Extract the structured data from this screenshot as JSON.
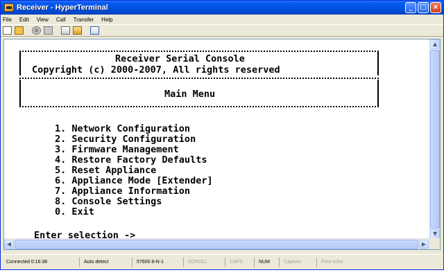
{
  "window": {
    "title": "Receiver - HyperTerminal",
    "controls": {
      "minimize": "_",
      "maximize": "□",
      "close": "×"
    }
  },
  "menubar": {
    "items": [
      "File",
      "Edit",
      "View",
      "Call",
      "Transfer",
      "Help"
    ]
  },
  "toolbar": {
    "icons": [
      "new-icon",
      "open-icon",
      "connect-icon",
      "disconnect-icon",
      "send-icon",
      "receive-icon",
      "properties-icon"
    ]
  },
  "terminal": {
    "header_title": "Receiver Serial Console",
    "header_copyright": "Copyright (c) 2000-2007, All rights reserved",
    "menu_title": "Main Menu",
    "options": [
      "1. Network Configuration",
      "2. Security Configuration",
      "3. Firmware Management",
      "4. Restore Factory Defaults",
      "5. Reset Appliance",
      "6. Appliance Mode [Extender]",
      "7. Appliance Information",
      "8. Console Settings",
      "0. Exit"
    ],
    "prompt": "Enter selection -> _"
  },
  "statusbar": {
    "connected": "Connected 0:16:38",
    "detect": "Auto detect",
    "settings": "57600 8-N-1",
    "scroll": "SCROLL",
    "caps": "CAPS",
    "num": "NUM",
    "capture": "Capture",
    "print_echo": "Print echo"
  }
}
